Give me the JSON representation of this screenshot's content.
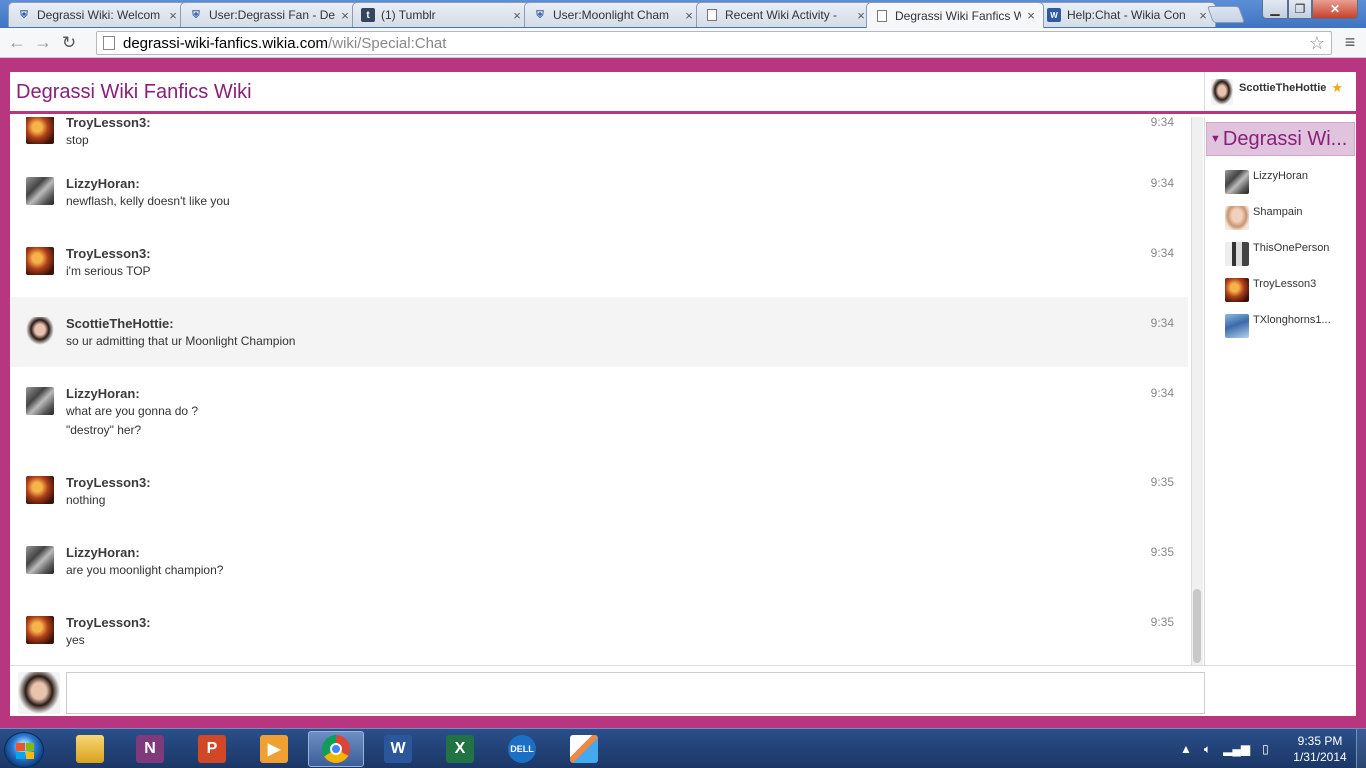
{
  "browser": {
    "tabs": [
      {
        "title": "Degrassi Wiki: Welcom",
        "icon": "wikia-shield-icon"
      },
      {
        "title": "User:Degrassi Fan - De",
        "icon": "wikia-shield-icon"
      },
      {
        "title": "(1) Tumblr",
        "icon": "tumblr-icon"
      },
      {
        "title": "User:Moonlight Cham",
        "icon": "wikia-shield-icon"
      },
      {
        "title": "Recent Wiki Activity -",
        "icon": "page-icon"
      },
      {
        "title": "Degrassi Wiki Fanfics W",
        "icon": "page-icon"
      },
      {
        "title": "Help:Chat - Wikia Con",
        "icon": "wikia-icon"
      }
    ],
    "tab_close": "×",
    "url_host": "degrassi-wiki-fanfics.wikia.com",
    "url_path": "/wiki/Special:Chat"
  },
  "chat": {
    "wiki_name": "Degrassi Wiki Fanfics Wiki",
    "current_user": "ScottieTheHottie",
    "messages": [
      {
        "author": "TroyLesson3:",
        "lines": [
          "stop"
        ],
        "time": "9:34"
      },
      {
        "author": "LizzyHoran:",
        "lines": [
          "newflash, kelly doesn't like you"
        ],
        "time": "9:34"
      },
      {
        "author": "TroyLesson3:",
        "lines": [
          "i'm serious TOP"
        ],
        "time": "9:34"
      },
      {
        "author": "ScottieTheHottie:",
        "lines": [
          "so ur admitting that ur Moonlight Champion"
        ],
        "time": "9:34"
      },
      {
        "author": "LizzyHoran:",
        "lines": [
          "what are you gonna do ?",
          "\"destroy\" her?"
        ],
        "time": "9:34"
      },
      {
        "author": "TroyLesson3:",
        "lines": [
          "nothing"
        ],
        "time": "9:35"
      },
      {
        "author": "LizzyHoran:",
        "lines": [
          "are you moonlight champion?"
        ],
        "time": "9:35"
      },
      {
        "author": "TroyLesson3:",
        "lines": [
          "yes"
        ],
        "time": "9:35"
      }
    ],
    "room_title": "Degrassi Wi...",
    "users": [
      "LizzyHoran",
      "Shampain",
      "ThisOnePerson",
      "TroyLesson3",
      "TXlonghorns1..."
    ]
  },
  "taskbar": {
    "clock_time": "9:35 PM",
    "clock_date": "1/31/2014"
  },
  "colors": {
    "wikia_accent": "#b7367f",
    "title_purple": "#8a1f7a"
  }
}
